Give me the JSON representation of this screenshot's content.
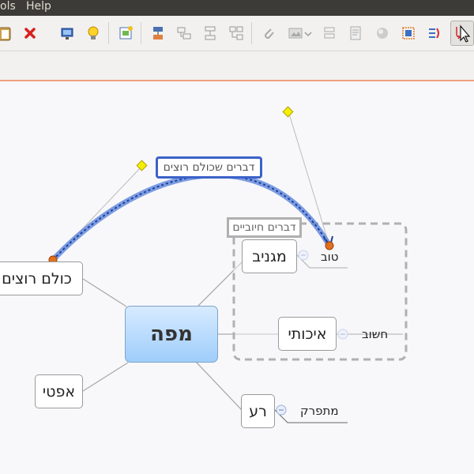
{
  "menu": {
    "tools": "ols",
    "help": "Help"
  },
  "toolbar": {
    "buttons": [
      "paste-icon",
      "delete-icon",
      "presentation-icon",
      "idea-icon",
      "insert-topic-icon",
      "insert-subtopic-icon",
      "insert-floating-topic-icon",
      "insert-summary-icon",
      "insert-relationship-icon",
      "attachment-icon",
      "insert-image-icon",
      "boundary-icon",
      "notes-icon",
      "marker-icon",
      "boundary-box-icon",
      "summary-icon",
      "link-toggle-icon"
    ]
  },
  "map": {
    "central": "מפה",
    "topics": {
      "everyone_wants": "כולם רוצים",
      "apathy": "אפטי",
      "disgusting": "מגניב",
      "quality": "איכותי",
      "bad": "רע"
    },
    "subtopics": {
      "good": "טוב",
      "important": "חשוב",
      "disgusting_sub": "מתפרק"
    },
    "boundary_label": "דברים חיוביים",
    "relationship_label": "דברים שכולם רוצים",
    "colors": {
      "relationship": "#3b62c8",
      "central_fill": "#a9d3fc",
      "handle": "#e8e800",
      "endpoint": "#e07020"
    }
  }
}
